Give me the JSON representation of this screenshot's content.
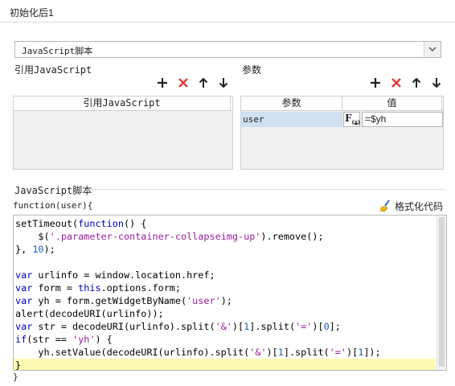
{
  "window": {
    "title": "初始化后1"
  },
  "select": {
    "value": "JavaScript脚本"
  },
  "left_panel": {
    "label": "引用JavaScript",
    "column_header": "引用JavaScript"
  },
  "right_panel": {
    "label": "参数",
    "headers": [
      "参数",
      "值"
    ],
    "rows": [
      {
        "name": "user",
        "type_icon": "F(x)",
        "value": "=$yh"
      }
    ]
  },
  "script_section": {
    "label": "JavaScript脚本",
    "function_signature": "function(user){",
    "closing_brace": "}",
    "format_button": "格式化代码"
  },
  "code": {
    "active_line_index": 11,
    "lines": [
      "setTimeout(function() {",
      "    $('.parameter-container-collapseimg-up').remove();",
      "}, 10);",
      "",
      "var urlinfo = window.location.href;",
      "var form = this.options.form;",
      "var yh = form.getWidgetByName('user');",
      "alert(decodeURI(urlinfo));",
      "var str = decodeURI(urlinfo).split('&')[1].split('=')[0];",
      "if(str == 'yh') {",
      "    yh.setValue(decodeURI(urlinfo).split('&')[1].split('=')[1]);",
      "}"
    ]
  },
  "toolbar_icons": [
    "add-icon",
    "delete-icon",
    "move-up-icon",
    "move-down-icon"
  ],
  "colors": {
    "add": "#222222",
    "delete": "#e03b3b",
    "keyword": "#0000c0",
    "string": "#9b1c9b",
    "number": "#1d5fb5",
    "selected_row": "#cfe0f0",
    "active_line": "#fdfab3"
  }
}
